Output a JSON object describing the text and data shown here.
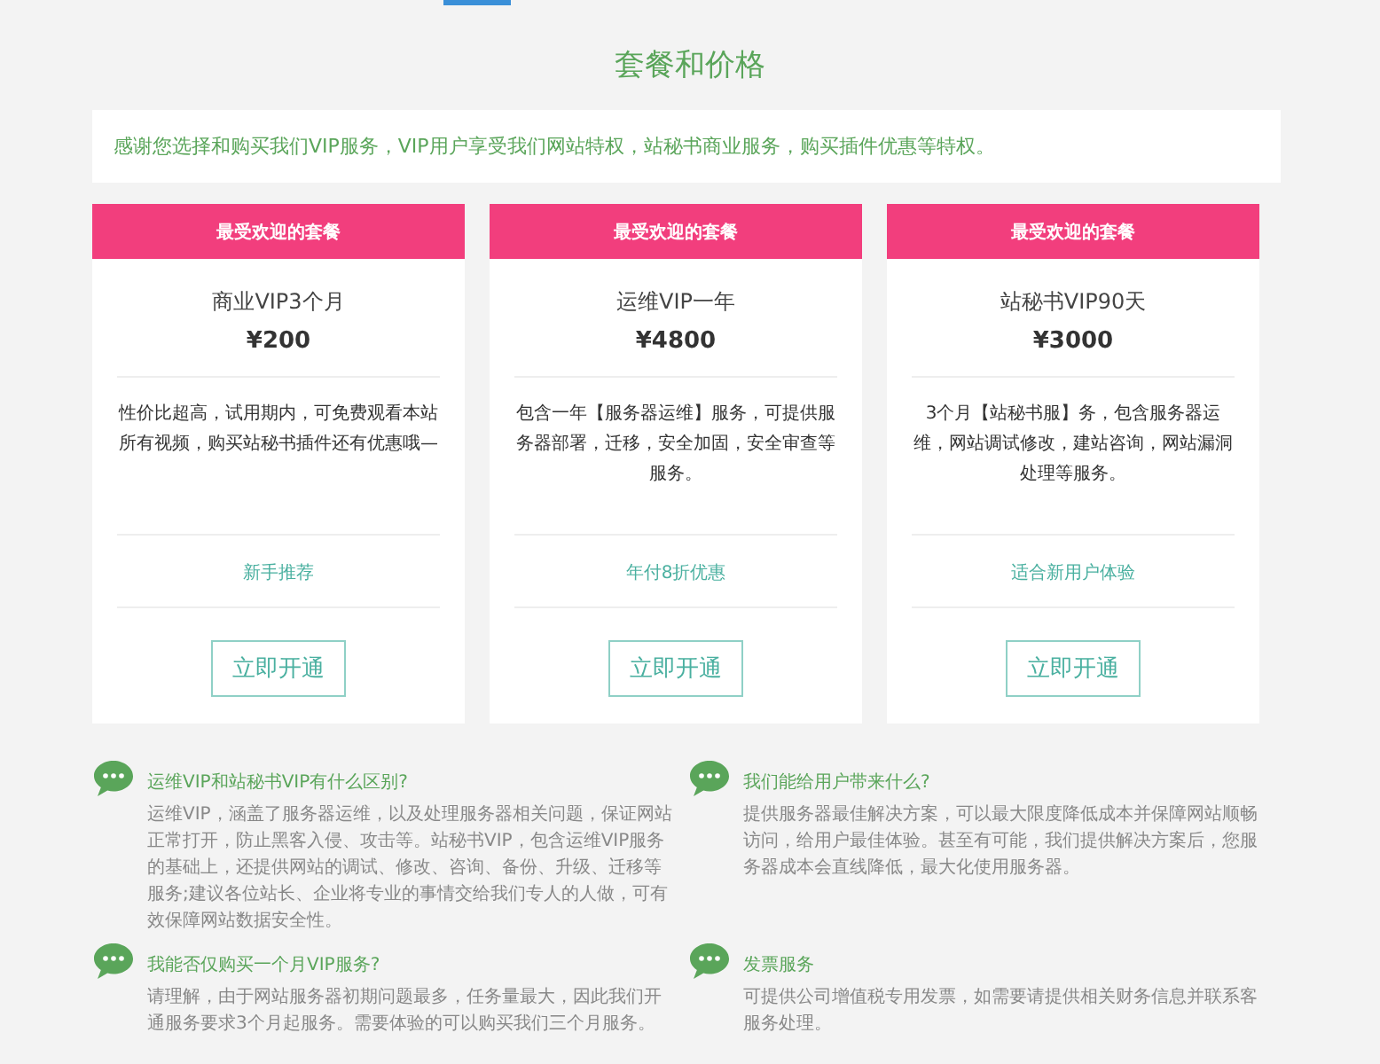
{
  "title": "套餐和价格",
  "notice": "感谢您选择和购买我们VIP服务，VIP用户享受我们网站特权，站秘书商业服务，购买插件优惠等特权。",
  "plans": [
    {
      "badge": "最受欢迎的套餐",
      "name": "商业VIP3个月",
      "price": "¥200",
      "description": "性价比超高，试用期内，可免费观看本站所有视频，购买站秘书插件还有优惠哦—",
      "tag": "新手推荐",
      "button": "立即开通"
    },
    {
      "badge": "最受欢迎的套餐",
      "name": "运维VIP一年",
      "price": "¥4800",
      "description": "包含一年【服务器运维】服务，可提供服务器部署，迁移，安全加固，安全审查等服务。",
      "tag": "年付8折优惠",
      "button": "立即开通"
    },
    {
      "badge": "最受欢迎的套餐",
      "name": "站秘书VIP90天",
      "price": "¥3000",
      "description": "3个月【站秘书服】务，包含服务器运维，网站调试修改，建站咨询，网站漏洞处理等服务。",
      "tag": "适合新用户体验",
      "button": "立即开通"
    }
  ],
  "faq": [
    {
      "question": "运维VIP和站秘书VIP有什么区别?",
      "answer": "运维VIP，涵盖了服务器运维，以及处理服务器相关问题，保证网站正常打开，防止黑客入侵、攻击等。站秘书VIP，包含运维VIP服务的基础上，还提供网站的调试、修改、咨询、备份、升级、迁移等服务;建议各位站长、企业将专业的事情交给我们专人的人做，可有效保障网站数据安全性。"
    },
    {
      "question": "我们能给用户带来什么?",
      "answer": "提供服务器最佳解决方案，可以最大限度降低成本并保障网站顺畅访问，给用户最佳体验。甚至有可能，我们提供解决方案后，您服务器成本会直线降低，最大化使用服务器。"
    },
    {
      "question": "我能否仅购买一个月VIP服务?",
      "answer": "请理解，由于网站服务器初期问题最多，任务量最大，因此我们开通服务要求3个月起服务。需要体验的可以购买我们三个月服务。"
    },
    {
      "question": "发票服务",
      "answer": "可提供公司增值税专用发票，如需要请提供相关财务信息并联系客服务处理。"
    }
  ]
}
